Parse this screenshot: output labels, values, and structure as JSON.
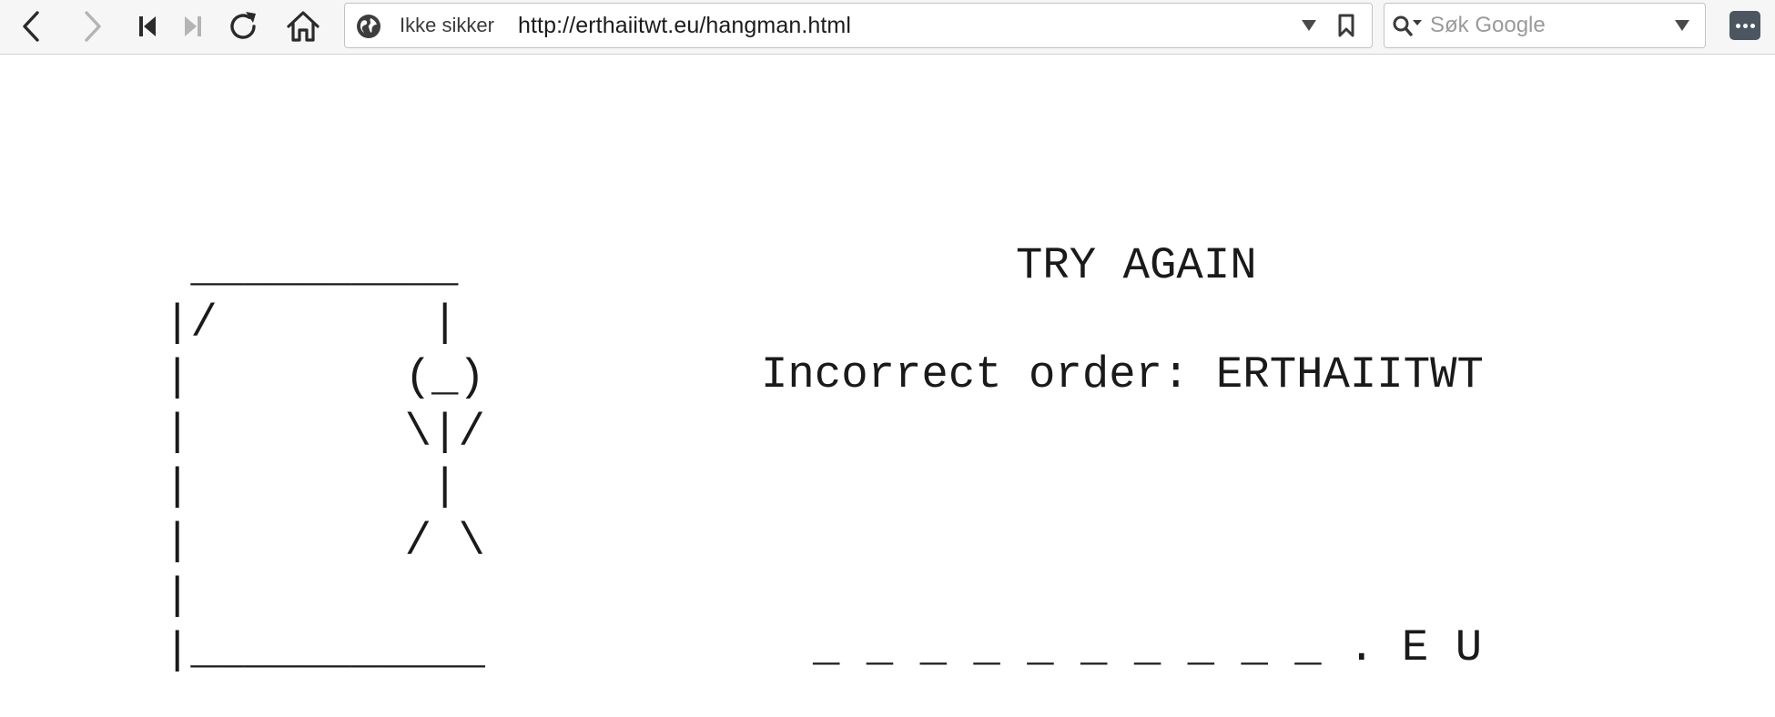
{
  "browser": {
    "security_label": "Ikke sikker",
    "url": "http://erthaiitwt.eu/hangman.html",
    "search_placeholder": "Søk Google",
    "icons": {
      "back": "back-icon",
      "forward": "forward-icon",
      "first": "skip-first-icon",
      "last": "skip-last-icon",
      "reload": "reload-icon",
      "home": "home-icon",
      "site_info": "globe-icon",
      "url_dropdown": "chevron-down-icon",
      "bookmark": "bookmark-icon",
      "search": "search-icon",
      "search_dropdown": "chevron-down-icon",
      "menu": "menu-icon"
    },
    "colors": {
      "toolbar_bg": "#f6f6f6",
      "menu_button_bg": "#4c5661"
    }
  },
  "game": {
    "gallows_art": " __________\n|/        |\n|        (_)\n|        \\|/\n|         |\n|        / \\\n|\n|___________",
    "status": "TRY AGAIN",
    "message": "Incorrect order: ERTHAIITWT",
    "word_display": "_ _ _ _ _ _ _ _ _ _ . E U"
  }
}
